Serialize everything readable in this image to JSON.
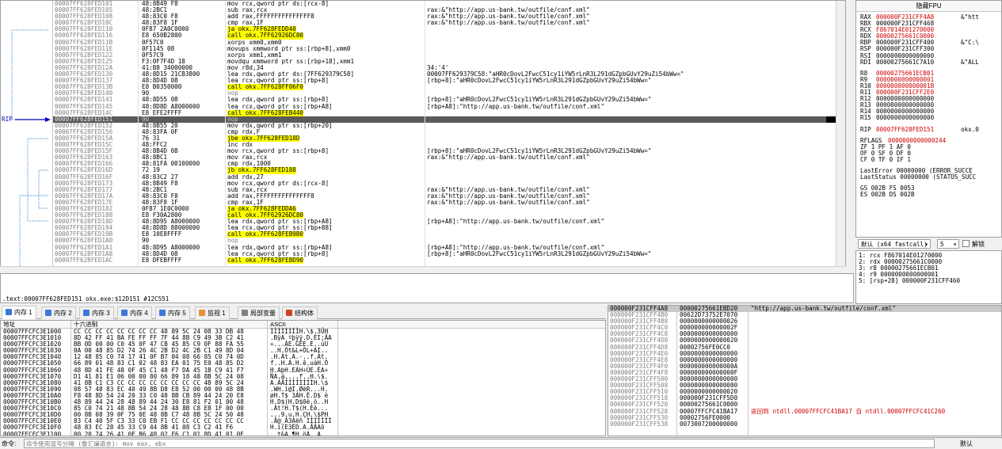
{
  "disasm": {
    "rows": [
      {
        "addr": "00007FF628FED101",
        "bytes": "48:8B49 F8",
        "instr": "mov rcx,qword ptr ds:[rcx-8]",
        "cmt": ""
      },
      {
        "addr": "00007FF628FED105",
        "bytes": "48:2BC1",
        "instr": "sub rax,rcx",
        "cmt": "rax:&\"http://app.us-bank.tw/outfile/conf.xml\""
      },
      {
        "addr": "00007FF628FED108",
        "bytes": "48:83C0 F8",
        "instr": "add rax,FFFFFFFFFFFFFFF8",
        "cmt": "rax:&\"http://app.us-bank.tw/outfile/conf.xml\""
      },
      {
        "addr": "00007FF628FED10C",
        "bytes": "48:83F8 1F",
        "instr": "cmp rax,1F",
        "cmt": "rax:&\"http://app.us-bank.tw/outfile/conf.xml\""
      },
      {
        "addr": "00007FF628FED110",
        "bytes": "0F87 2A0C0000",
        "instr": "ja okx.7FF628FEDD40",
        "cmt": "",
        "hl": "yellow"
      },
      {
        "addr": "00007FF628FED116",
        "bytes": "E8 650B2800",
        "instr": "call okx.7FF62926DC80",
        "cmt": "",
        "hl": "yellow"
      },
      {
        "addr": "00007FF628FED11B",
        "bytes": "0F57C0",
        "instr": "xorps xmm0,xmm0",
        "cmt": ""
      },
      {
        "addr": "00007FF628FED11E",
        "bytes": "0F1145 08",
        "instr": "movups xmmword ptr ss:[rbp+8],xmm0",
        "cmt": ""
      },
      {
        "addr": "00007FF628FED122",
        "bytes": "0F57C9",
        "instr": "xorps xmm1,xmm1",
        "cmt": ""
      },
      {
        "addr": "00007FF628FED125",
        "bytes": "F3:0F7F4D 18",
        "instr": "movdqu xmmword ptr ss:[rbp+18],xmm1",
        "cmt": ""
      },
      {
        "addr": "00007FF628FED12A",
        "bytes": "41:B8 34000000",
        "instr": "mov r8d,34",
        "cmt": "34:'4'"
      },
      {
        "addr": "00007FF628FED130",
        "bytes": "48:8D15 21CB3800",
        "instr": "lea rdx,qword ptr ds:[7FF629379C58]",
        "cmt": "00007FF629379C58:\"aHR0cDovL2FwcC51cy1iYW5rLnR3L291dGZpbGUvY29uZi54bWw=\""
      },
      {
        "addr": "00007FF628FED137",
        "bytes": "48:8D4D 08",
        "instr": "lea rcx,qword ptr ss:[rbp+8]",
        "cmt": "[rbp+8]:\"aHR0cDovL2FwcC51cy1iYW5rLnR3L291dGZpbGUvY29uZi54bWw=\""
      },
      {
        "addr": "00007FF628FED13B",
        "bytes": "E8 B0350000",
        "instr": "call okx.7FF628FF06F0",
        "cmt": "",
        "hl": "yellow"
      },
      {
        "addr": "00007FF628FED140",
        "bytes": "90",
        "instr": "nop",
        "cmt": "",
        "hl": "nop"
      },
      {
        "addr": "00007FF628FED141",
        "bytes": "48:8D55 08",
        "instr": "lea rdx,qword ptr ss:[rbp+8]",
        "cmt": "[rbp+8]:\"aHR0cDovL2FwcC51cy1iYW5rLnR3L291dGZpbGUvY29uZi54bWw=\""
      },
      {
        "addr": "00007FF628FED145",
        "bytes": "48:8D8D A8000000",
        "instr": "lea rcx,qword ptr ss:[rbp+A8]",
        "cmt": "[rbp+A8]:\"http://app.us-bank.tw/outfile/conf.xml\""
      },
      {
        "addr": "00007FF628FED14C",
        "bytes": "E8 EFE2FFFF",
        "instr": "call okx.7FF628FEB440",
        "cmt": "",
        "hl": "yellow"
      },
      {
        "addr": "00007FF628FED151",
        "bytes": "90",
        "instr": "nop",
        "cmt": "",
        "rip": true
      },
      {
        "addr": "00007FF628FED152",
        "bytes": "48:8B55 20",
        "instr": "mov rdx,qword ptr ss:[rbp+20]",
        "cmt": ""
      },
      {
        "addr": "00007FF628FED156",
        "bytes": "48:83FA 0F",
        "instr": "cmp rdx,F",
        "cmt": ""
      },
      {
        "addr": "00007FF628FED15A",
        "bytes": "76 31",
        "instr": "jbe okx.7FF628FED18D",
        "cmt": "",
        "hl": "yellow"
      },
      {
        "addr": "00007FF628FED15C",
        "bytes": "48:FFC2",
        "instr": "inc rdx",
        "cmt": ""
      },
      {
        "addr": "00007FF628FED15F",
        "bytes": "48:8B4D 08",
        "instr": "mov rcx,qword ptr ss:[rbp+8]",
        "cmt": "[rbp+8]:\"aHR0cDovL2FwcC51cy1iYW5rLnR3L291dGZpbGUvY29uZi54bWw=\""
      },
      {
        "addr": "00007FF628FED163",
        "bytes": "48:8BC1",
        "instr": "mov rax,rcx",
        "cmt": "rax:&\"http://app.us-bank.tw/outfile/conf.xml\""
      },
      {
        "addr": "00007FF628FED166",
        "bytes": "48:81FA 00100000",
        "instr": "cmp rdx,1000",
        "cmt": ""
      },
      {
        "addr": "00007FF628FED16D",
        "bytes": "72 19",
        "instr": "jb okx.7FF628FED188",
        "cmt": "",
        "hl": "yellow"
      },
      {
        "addr": "00007FF628FED16F",
        "bytes": "48:83C2 27",
        "instr": "add rdx,27",
        "cmt": ""
      },
      {
        "addr": "00007FF628FED173",
        "bytes": "48:8B49 F8",
        "instr": "mov rcx,qword ptr ds:[rcx-8]",
        "cmt": ""
      },
      {
        "addr": "00007FF628FED177",
        "bytes": "48:2BC1",
        "instr": "sub rax,rcx",
        "cmt": "rax:&\"http://app.us-bank.tw/outfile/conf.xml\""
      },
      {
        "addr": "00007FF628FED17A",
        "bytes": "48:83C0 F8",
        "instr": "add rax,FFFFFFFFFFFFFFF8",
        "cmt": "rax:&\"http://app.us-bank.tw/outfile/conf.xml\""
      },
      {
        "addr": "00007FF628FED17E",
        "bytes": "48:83F8 1F",
        "instr": "cmp rax,1F",
        "cmt": "rax:&\"http://app.us-bank.tw/outfile/conf.xml\""
      },
      {
        "addr": "00007FF628FED182",
        "bytes": "0F87 1E0C0000",
        "instr": "ja okx.7FF628FEDDA6",
        "cmt": "",
        "hl": "yellow"
      },
      {
        "addr": "00007FF628FED188",
        "bytes": "E8 F30A2800",
        "instr": "call okx.7FF62926DC80",
        "cmt": "",
        "hl": "yellow"
      },
      {
        "addr": "00007FF628FED18D",
        "bytes": "48:8D95 A8000000",
        "instr": "lea rdx,qword ptr ss:[rbp+A8]",
        "cmt": "[rbp+A8]:\"http://app.us-bank.tw/outfile/conf.xml\""
      },
      {
        "addr": "00007FF628FED194",
        "bytes": "48:8D8D 88000000",
        "instr": "lea rcx,qword ptr ss:[rbp+88]",
        "cmt": ""
      },
      {
        "addr": "00007FF628FED19B",
        "bytes": "E8 10E8FFFF",
        "instr": "call okx.7FF628FEB9B0",
        "cmt": "",
        "hl": "yellow"
      },
      {
        "addr": "00007FF628FED1A0",
        "bytes": "90",
        "instr": "nop",
        "cmt": "",
        "hl": "nop"
      },
      {
        "addr": "00007FF628FED1A1",
        "bytes": "48:8D95 A8000000",
        "instr": "lea rdx,qword ptr ss:[rbp+A8]",
        "cmt": "[rbp+A8]:\"http://app.us-bank.tw/outfile/conf.xml\""
      },
      {
        "addr": "00007FF628FED1A8",
        "bytes": "48:8D4D 08",
        "instr": "lea rcx,qword ptr ss:[rbp+8]",
        "cmt": "[rbp+8]:\"aHR0cDovL2FwcC51cy1iYW5rLnR3L291dGZpbGUvY29uZi54bWw=\""
      },
      {
        "addr": "00007FF628FED1AC",
        "bytes": "E8 DFEBFFFF",
        "instr": "call okx.7FF628FEBD90",
        "cmt": "",
        "hl": "yellow"
      }
    ],
    "rip_label": "RIP"
  },
  "registers": {
    "title": "隐藏FPU",
    "gp": [
      {
        "name": "RAX",
        "val": "000000F231CFF4A8",
        "cmt": "&\"htt",
        "red": true
      },
      {
        "name": "RBX",
        "val": "000000F231CFF468",
        "cmt": ""
      },
      {
        "name": "RCX",
        "val": "F867014E01270000",
        "cmt": "",
        "red": true
      },
      {
        "name": "RDX",
        "val": "00000275661C0000",
        "cmt": "",
        "red": true
      },
      {
        "name": "RBP",
        "val": "000000F231CFF400",
        "cmt": "&\"C:\\"
      },
      {
        "name": "RSP",
        "val": "000000F231CFF300",
        "cmt": ""
      },
      {
        "name": "RSI",
        "val": "0000000000000000",
        "cmt": ""
      },
      {
        "name": "RDI",
        "val": "00000275661C7A10",
        "cmt": "&\"ALL"
      }
    ],
    "ext": [
      {
        "name": "R8",
        "val": "00000275661ECB01",
        "red": true
      },
      {
        "name": "R9",
        "val": "0000000000000001",
        "red": true
      },
      {
        "name": "R10",
        "val": "000000000000001B",
        "red": true
      },
      {
        "name": "R11",
        "val": "000000F231CFF2E0",
        "red": true
      },
      {
        "name": "R12",
        "val": "0000000000000000"
      },
      {
        "name": "R13",
        "val": "0000000000000000"
      },
      {
        "name": "R14",
        "val": "0000000000000000"
      },
      {
        "name": "R15",
        "val": "0000000000000000"
      }
    ],
    "rip": {
      "name": "RIP",
      "val": "00007FF628FED151",
      "cmt": "okx.0"
    },
    "rflags": {
      "name": "RFLAGS",
      "val": "0000000000000244"
    },
    "flags": [
      "ZF 1  PF 1  AF 0",
      "OF 0  SF 0  DF 0",
      "CF 0  TF 0  IF 1"
    ],
    "lasterror": "LastError  00000000 (ERROR_SUCCE",
    "laststatus": "LastStatus 00000000 (STATUS_SUCC",
    "seg1": "GS 002B  FS 0053",
    "seg2": "ES 002B  DS 002B"
  },
  "callconv": {
    "label": "默认 (x64 fastcall)",
    "count": "5",
    "unlock": "解锁"
  },
  "args": [
    "1: rcx F867014E01270000",
    "2: rdx 00000275661C0000",
    "3: r8 00000275661ECB01",
    "4: r9 0000000000000001",
    "5: [rsp+28] 000000F231CFF460"
  ],
  "status_info": ".text:00007FF628FED151 okx.exe:$12D151 #12C551",
  "tabs": [
    {
      "label": "内存 1",
      "color": "#3c78d8"
    },
    {
      "label": "内存 2",
      "color": "#3c78d8"
    },
    {
      "label": "内存 3",
      "color": "#3c78d8"
    },
    {
      "label": "内存 4",
      "color": "#3c78d8"
    },
    {
      "label": "内存 5",
      "color": "#3c78d8"
    },
    {
      "label": "监视 1",
      "color": "#e69138"
    },
    {
      "label": "局部变量",
      "color": "#808080"
    },
    {
      "label": "结构体",
      "color": "#cc4125"
    }
  ],
  "dump": {
    "headers": [
      "地址",
      "十六进制",
      "ASCII"
    ],
    "rows": [
      {
        "addr": "00007FFCFC3E1000",
        "hex": "CC CC CC CC CC CC CC CC 48 89 5C 24 08 33 DB 48",
        "ascii": "ÌÌÌÌÌÌÌÌH.\\$.3ÛH"
      },
      {
        "addr": "00007FFCFC3E1010",
        "hex": "8D 42 FF 41 BA FE FF FF 7F 44 8B C9 49 3B C2 41",
        "ascii": ".BÿA ºþÿÿ.D.ÉI;ÂA"
      },
      {
        "addr": "00007FFCFC3E1020",
        "hex": "BB 0D 00 00 C0 45 0F 47 CB 45 85 C9 0F 88 FA 55",
        "ascii": "»...ÀE.GËE.É..úU"
      },
      {
        "addr": "00007FFCFC3E1030",
        "hex": "0A 00 48 85 D2 74 26 4C 2B D2 4C 2B C1 49 8D 04",
        "ascii": "..H.Òt&L+ÒL+ÁI.."
      },
      {
        "addr": "00007FFCFC3E1040",
        "hex": "12 48 85 C0 74 17 41 0F B7 04 08 66 85 C0 74 0D",
        "ascii": ".H.Àt.A.·..f.Àt."
      },
      {
        "addr": "00007FFCFC3E1050",
        "hex": "66 89 01 48 83 C1 02 48 83 EA 01 75 E0 48 85 D2",
        "ascii": "f..H.Á.H.ê.uàH.Ò"
      },
      {
        "addr": "00007FFCFC3E1060",
        "hex": "48 8D 41 FE 48 0F 45 C1 48 F7 DA 45 1B C9 41 F7",
        "ascii": "H.AþH.EÁH÷ÚE.ÉA÷"
      },
      {
        "addr": "00007FFCFC3E1070",
        "hex": "D1 41 81 E1 06 00 00 80 66 89 18 48 8B 5C 24 08",
        "ascii": "ÑA.á....f..H.\\$."
      },
      {
        "addr": "00007FFCFC3E1080",
        "hex": "41 8B C1 C3 CC CC CC CC CC CC CC CC 48 89 5C 24",
        "ascii": "A.ÁÃÌÌÌÌÌÌÌÌH.\\$"
      },
      {
        "addr": "00007FFCFC3E1090",
        "hex": "08 57 48 83 EC 40 49 8B D8 E8 52 00 00 00 48 8B",
        "ascii": ".WH.ì@I.ØèR...H."
      },
      {
        "addr": "00007FFCFC3E10A0",
        "hex": "F8 48 8D 54 24 20 33 C0 48 8B CB 89 44 24 20 E8",
        "ascii": "øH.T$ 3ÀH.Ë.D$ è"
      },
      {
        "addr": "00007FFCFC3E10B0",
        "hex": "48 89 44 24 28 48 89 44 24 30 E8 81 F2 01 00 48",
        "ascii": "H.D$(H.D$0è.ò..H"
      },
      {
        "addr": "00007FFCFC3E10C0",
        "hex": "85 C0 74 21 48 8B 54 24 28 48 8B C8 E8 1F 00 00",
        "ascii": ".Àt!H.T$(H.Èè..."
      },
      {
        "addr": "00007FFCFC3E10D0",
        "hex": "00 8B 08 39 0F 75 0E 48 8B C7 48 8B 5C 24 50 48",
        "ascii": "...9.u.H.ÇH.\\$PH"
      },
      {
        "addr": "00007FFCFC3E10E0",
        "hex": "83 C4 40 5F C3 33 C0 EB F1 CC CC CC CC CC CC CC",
        "ascii": ".Ä@_Ã3Àëñ ÌÌÌÌÌÌÌ"
      },
      {
        "addr": "00007FFCFC3E10F0",
        "hex": "48 83 EC 28 45 33 C9 44 8B 41 08 C3 C2 41 F6",
        "ascii": "H.ì(E3ÉD.A.ÃÂAö"
      },
      {
        "addr": "00007FFCFC3E1100",
        "hex": "00 20 74 26 41 0F B6 48 02 F6 C1 01 8D 41 01 0F",
        "ascii": ". t&A.¶H.öÁ..A.."
      }
    ]
  },
  "stack": {
    "rows": [
      {
        "addr": "000000F231CFF4A8",
        "val": "00000275661EBD20",
        "cmt": "\"http://app.us-bank.tw/outfile/conf.xml\"",
        "top": true
      },
      {
        "addr": "000000F231CFF4B0",
        "val": "00622D73752E7070",
        "cmt": ""
      },
      {
        "addr": "000000F231CFF4B8",
        "val": "0000000000000026",
        "cmt": ""
      },
      {
        "addr": "000000F231CFF4C0",
        "val": "000000000000002F",
        "cmt": ""
      },
      {
        "addr": "000000F231CFF4C8",
        "val": "0000000000000000",
        "cmt": ""
      },
      {
        "addr": "000000F231CFF4D0",
        "val": "0000000000000020",
        "cmt": ""
      },
      {
        "addr": "000000F231CFF4D8",
        "val": "00002756FE0CC0",
        "cmt": ""
      },
      {
        "addr": "000000F231CFF4E0",
        "val": "0000000000000000",
        "cmt": ""
      },
      {
        "addr": "000000F231CFF4E8",
        "val": "0000000000000000",
        "cmt": ""
      },
      {
        "addr": "000000F231CFF4F0",
        "val": "000000000000000A",
        "cmt": ""
      },
      {
        "addr": "000000F231CFF4F8",
        "val": "000000000000000F",
        "cmt": ""
      },
      {
        "addr": "000000F231CFF500",
        "val": "0000000000000000",
        "cmt": ""
      },
      {
        "addr": "000000F231CFF508",
        "val": "0000000000000000",
        "cmt": ""
      },
      {
        "addr": "000000F231CFF510",
        "val": "0000000000000020",
        "cmt": ""
      },
      {
        "addr": "000000F231CFF518",
        "val": "000000F231CFF5D0",
        "cmt": ""
      },
      {
        "addr": "000000F231CFF520",
        "val": "00000275661C0000",
        "cmt": ""
      },
      {
        "addr": "000000F231CFF528",
        "val": "00007FFCFC41BA17",
        "cmt": "返回到 ntdll.00007FFCFC41BA17 自 ntdll.00007FFCFC41C260",
        "red": true
      },
      {
        "addr": "000000F231CFF530",
        "val": "00002756FE0000",
        "cmt": ""
      },
      {
        "addr": "000000F231CFF538",
        "val": "0073007200000000",
        "cmt": ""
      }
    ]
  },
  "cmdbar": {
    "label": "命令:",
    "placeholder": "命令使用逗号分隔 (像汇编语言): mov eax, ebx",
    "default": "默认"
  }
}
